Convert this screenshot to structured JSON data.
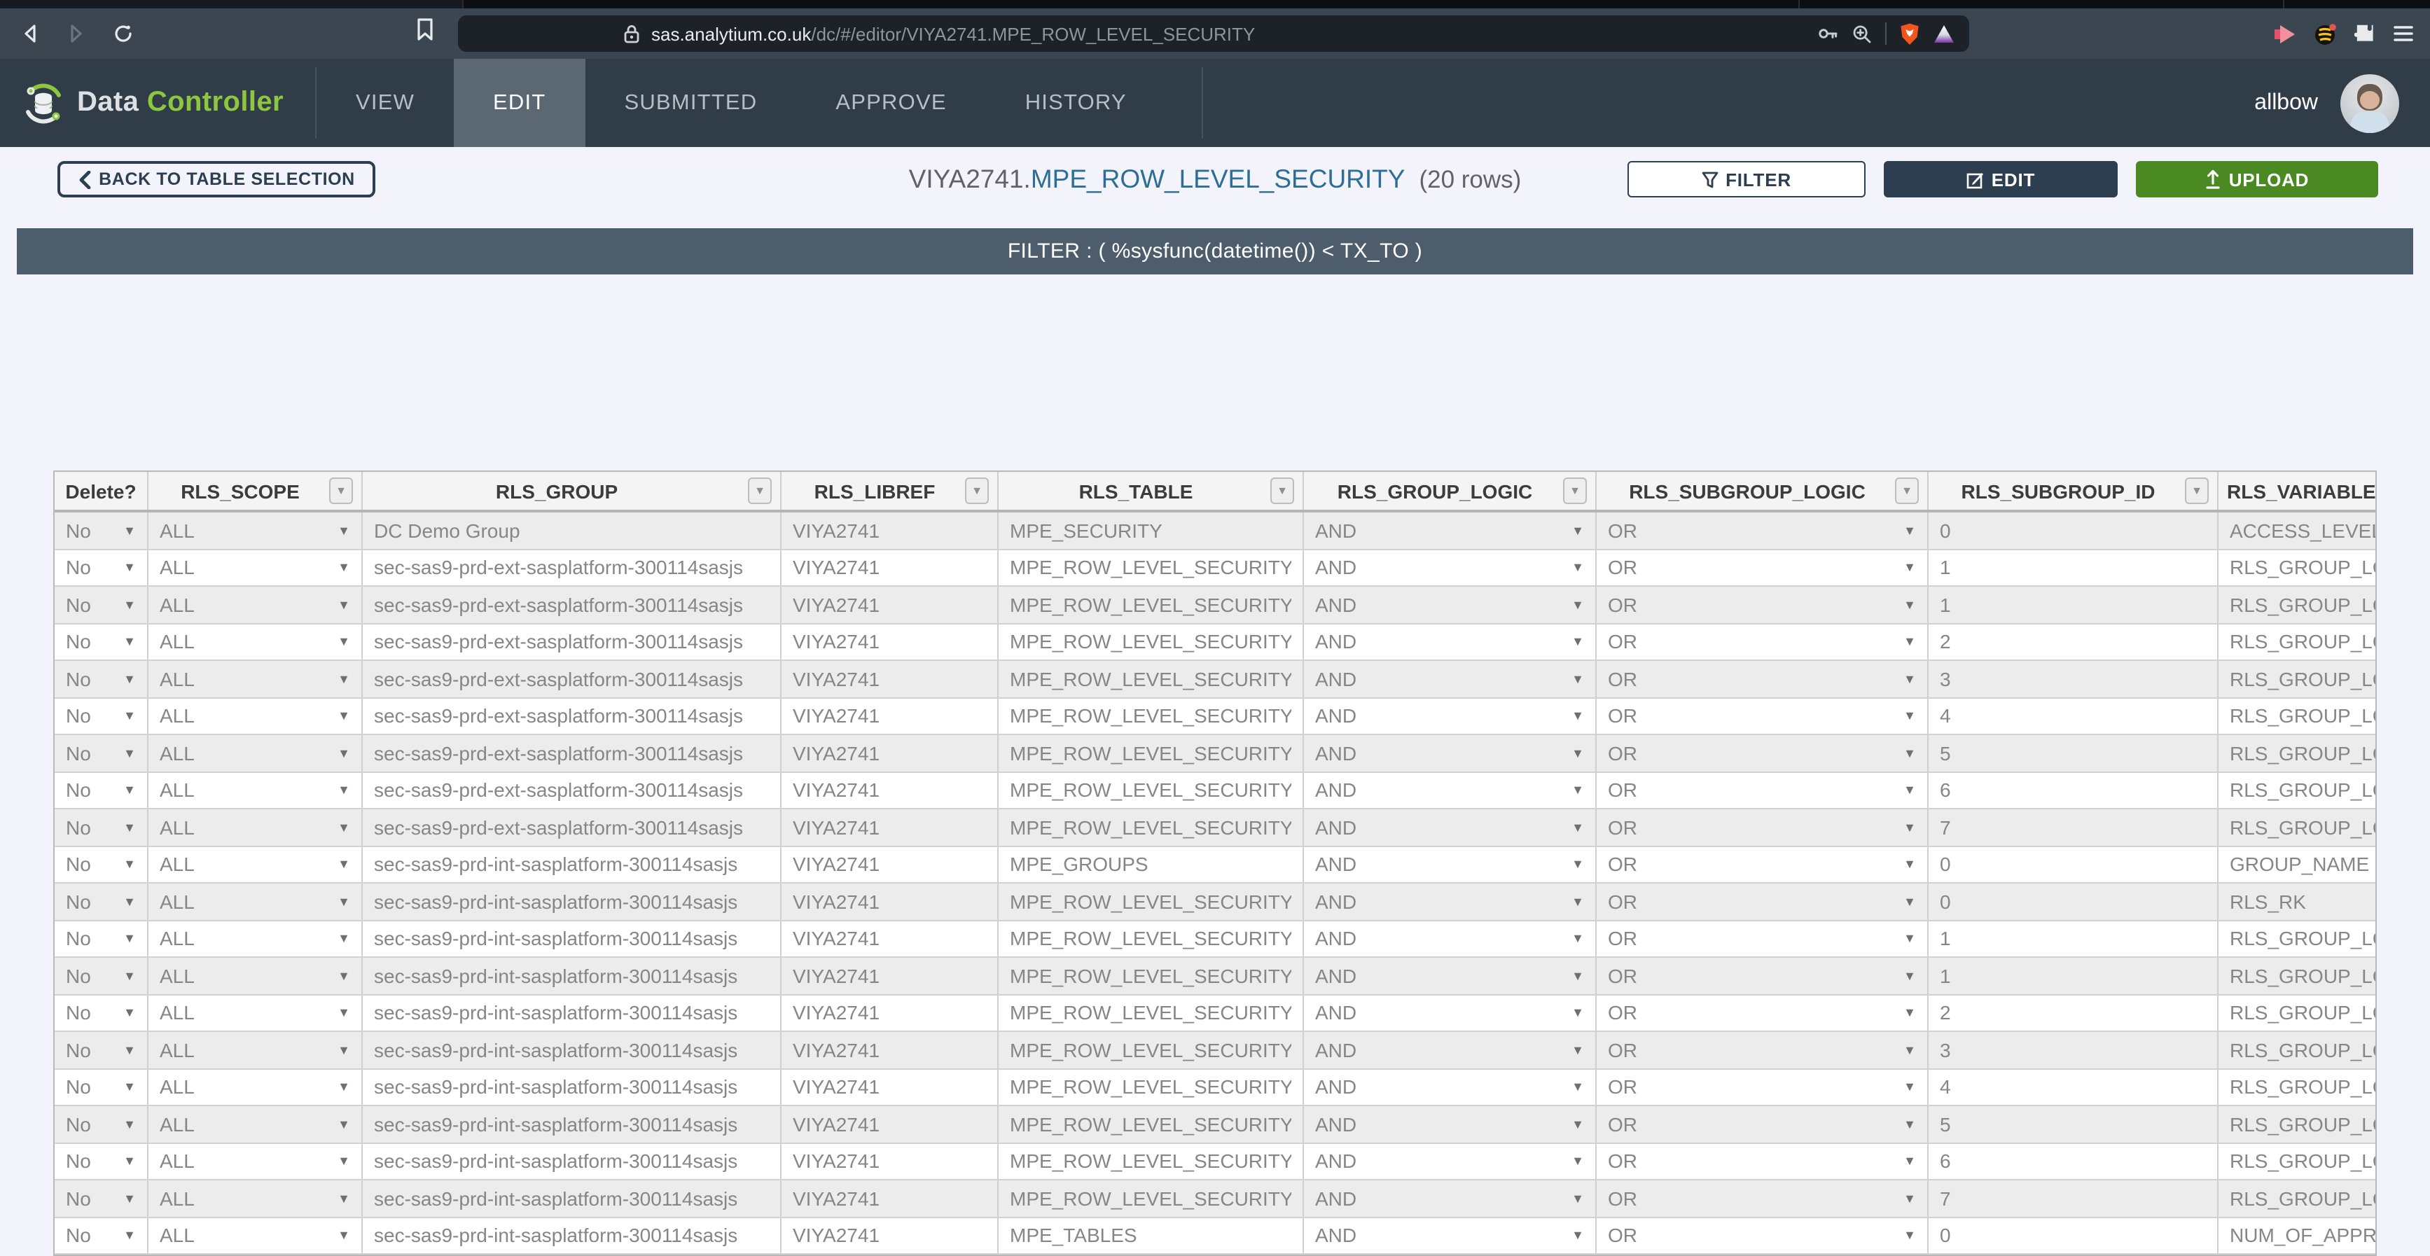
{
  "browser": {
    "url_host": "sas.analytium.co.uk",
    "url_path": "/dc/#/editor/VIYA2741.MPE_ROW_LEVEL_SECURITY"
  },
  "nav": {
    "brand_part1": "Data",
    "brand_part2": "Controller",
    "tabs": [
      {
        "label": "VIEW",
        "active": false
      },
      {
        "label": "EDIT",
        "active": true
      },
      {
        "label": "SUBMITTED",
        "active": false
      },
      {
        "label": "APPROVE",
        "active": false
      },
      {
        "label": "HISTORY",
        "active": false
      }
    ],
    "user": "allbow"
  },
  "header": {
    "back_label": "BACK TO TABLE SELECTION",
    "title_lib": "VIYA2741.",
    "title_table": "MPE_ROW_LEVEL_SECURITY",
    "title_rows": "(20 rows)",
    "filter_label": "FILTER",
    "edit_label": "EDIT",
    "upload_label": "UPLOAD"
  },
  "filter_bar": "FILTER : ( %sysfunc(datetime()) < TX_TO )",
  "table": {
    "columns": [
      {
        "key": "delete",
        "label": "Delete?",
        "filter_icon": false,
        "dropdown": true
      },
      {
        "key": "scope",
        "label": "RLS_SCOPE",
        "filter_icon": true,
        "dropdown": true
      },
      {
        "key": "group",
        "label": "RLS_GROUP",
        "filter_icon": true,
        "dropdown": false
      },
      {
        "key": "libref",
        "label": "RLS_LIBREF",
        "filter_icon": true,
        "dropdown": false
      },
      {
        "key": "table",
        "label": "RLS_TABLE",
        "filter_icon": true,
        "dropdown": false
      },
      {
        "key": "group_logic",
        "label": "RLS_GROUP_LOGIC",
        "filter_icon": true,
        "dropdown": true
      },
      {
        "key": "subgroup_logic",
        "label": "RLS_SUBGROUP_LOGIC",
        "filter_icon": true,
        "dropdown": true
      },
      {
        "key": "subgroup_id",
        "label": "RLS_SUBGROUP_ID",
        "filter_icon": true,
        "dropdown": false
      },
      {
        "key": "variable",
        "label": "RLS_VARIABLE_NM",
        "filter_icon": true,
        "dropdown": false
      }
    ],
    "rows": [
      {
        "delete": "No",
        "scope": "ALL",
        "group": "DC Demo Group",
        "libref": "VIYA2741",
        "table": "MPE_SECURITY",
        "group_logic": "AND",
        "subgroup_logic": "OR",
        "subgroup_id": "0",
        "variable": "ACCESS_LEVEL"
      },
      {
        "delete": "No",
        "scope": "ALL",
        "group": "sec-sas9-prd-ext-sasplatform-300114sasjs",
        "libref": "VIYA2741",
        "table": "MPE_ROW_LEVEL_SECURITY",
        "group_logic": "AND",
        "subgroup_logic": "OR",
        "subgroup_id": "1",
        "variable": "RLS_GROUP_LOGIC"
      },
      {
        "delete": "No",
        "scope": "ALL",
        "group": "sec-sas9-prd-ext-sasplatform-300114sasjs",
        "libref": "VIYA2741",
        "table": "MPE_ROW_LEVEL_SECURITY",
        "group_logic": "AND",
        "subgroup_logic": "OR",
        "subgroup_id": "1",
        "variable": "RLS_GROUP_LOGIC"
      },
      {
        "delete": "No",
        "scope": "ALL",
        "group": "sec-sas9-prd-ext-sasplatform-300114sasjs",
        "libref": "VIYA2741",
        "table": "MPE_ROW_LEVEL_SECURITY",
        "group_logic": "AND",
        "subgroup_logic": "OR",
        "subgroup_id": "2",
        "variable": "RLS_GROUP_LOGIC"
      },
      {
        "delete": "No",
        "scope": "ALL",
        "group": "sec-sas9-prd-ext-sasplatform-300114sasjs",
        "libref": "VIYA2741",
        "table": "MPE_ROW_LEVEL_SECURITY",
        "group_logic": "AND",
        "subgroup_logic": "OR",
        "subgroup_id": "3",
        "variable": "RLS_GROUP_LOGIC"
      },
      {
        "delete": "No",
        "scope": "ALL",
        "group": "sec-sas9-prd-ext-sasplatform-300114sasjs",
        "libref": "VIYA2741",
        "table": "MPE_ROW_LEVEL_SECURITY",
        "group_logic": "AND",
        "subgroup_logic": "OR",
        "subgroup_id": "4",
        "variable": "RLS_GROUP_LOGIC"
      },
      {
        "delete": "No",
        "scope": "ALL",
        "group": "sec-sas9-prd-ext-sasplatform-300114sasjs",
        "libref": "VIYA2741",
        "table": "MPE_ROW_LEVEL_SECURITY",
        "group_logic": "AND",
        "subgroup_logic": "OR",
        "subgroup_id": "5",
        "variable": "RLS_GROUP_LOGIC"
      },
      {
        "delete": "No",
        "scope": "ALL",
        "group": "sec-sas9-prd-ext-sasplatform-300114sasjs",
        "libref": "VIYA2741",
        "table": "MPE_ROW_LEVEL_SECURITY",
        "group_logic": "AND",
        "subgroup_logic": "OR",
        "subgroup_id": "6",
        "variable": "RLS_GROUP_LOGIC"
      },
      {
        "delete": "No",
        "scope": "ALL",
        "group": "sec-sas9-prd-ext-sasplatform-300114sasjs",
        "libref": "VIYA2741",
        "table": "MPE_ROW_LEVEL_SECURITY",
        "group_logic": "AND",
        "subgroup_logic": "OR",
        "subgroup_id": "7",
        "variable": "RLS_GROUP_LOGIC"
      },
      {
        "delete": "No",
        "scope": "ALL",
        "group": "sec-sas9-prd-int-sasplatform-300114sasjs",
        "libref": "VIYA2741",
        "table": "MPE_GROUPS",
        "group_logic": "AND",
        "subgroup_logic": "OR",
        "subgroup_id": "0",
        "variable": "GROUP_NAME"
      },
      {
        "delete": "No",
        "scope": "ALL",
        "group": "sec-sas9-prd-int-sasplatform-300114sasjs",
        "libref": "VIYA2741",
        "table": "MPE_ROW_LEVEL_SECURITY",
        "group_logic": "AND",
        "subgroup_logic": "OR",
        "subgroup_id": "0",
        "variable": "RLS_RK"
      },
      {
        "delete": "No",
        "scope": "ALL",
        "group": "sec-sas9-prd-int-sasplatform-300114sasjs",
        "libref": "VIYA2741",
        "table": "MPE_ROW_LEVEL_SECURITY",
        "group_logic": "AND",
        "subgroup_logic": "OR",
        "subgroup_id": "1",
        "variable": "RLS_GROUP_LOGIC"
      },
      {
        "delete": "No",
        "scope": "ALL",
        "group": "sec-sas9-prd-int-sasplatform-300114sasjs",
        "libref": "VIYA2741",
        "table": "MPE_ROW_LEVEL_SECURITY",
        "group_logic": "AND",
        "subgroup_logic": "OR",
        "subgroup_id": "1",
        "variable": "RLS_GROUP_LOGIC"
      },
      {
        "delete": "No",
        "scope": "ALL",
        "group": "sec-sas9-prd-int-sasplatform-300114sasjs",
        "libref": "VIYA2741",
        "table": "MPE_ROW_LEVEL_SECURITY",
        "group_logic": "AND",
        "subgroup_logic": "OR",
        "subgroup_id": "2",
        "variable": "RLS_GROUP_LOGIC"
      },
      {
        "delete": "No",
        "scope": "ALL",
        "group": "sec-sas9-prd-int-sasplatform-300114sasjs",
        "libref": "VIYA2741",
        "table": "MPE_ROW_LEVEL_SECURITY",
        "group_logic": "AND",
        "subgroup_logic": "OR",
        "subgroup_id": "3",
        "variable": "RLS_GROUP_LOGIC"
      },
      {
        "delete": "No",
        "scope": "ALL",
        "group": "sec-sas9-prd-int-sasplatform-300114sasjs",
        "libref": "VIYA2741",
        "table": "MPE_ROW_LEVEL_SECURITY",
        "group_logic": "AND",
        "subgroup_logic": "OR",
        "subgroup_id": "4",
        "variable": "RLS_GROUP_LOGIC"
      },
      {
        "delete": "No",
        "scope": "ALL",
        "group": "sec-sas9-prd-int-sasplatform-300114sasjs",
        "libref": "VIYA2741",
        "table": "MPE_ROW_LEVEL_SECURITY",
        "group_logic": "AND",
        "subgroup_logic": "OR",
        "subgroup_id": "5",
        "variable": "RLS_GROUP_LOGIC"
      },
      {
        "delete": "No",
        "scope": "ALL",
        "group": "sec-sas9-prd-int-sasplatform-300114sasjs",
        "libref": "VIYA2741",
        "table": "MPE_ROW_LEVEL_SECURITY",
        "group_logic": "AND",
        "subgroup_logic": "OR",
        "subgroup_id": "6",
        "variable": "RLS_GROUP_LOGIC"
      },
      {
        "delete": "No",
        "scope": "ALL",
        "group": "sec-sas9-prd-int-sasplatform-300114sasjs",
        "libref": "VIYA2741",
        "table": "MPE_ROW_LEVEL_SECURITY",
        "group_logic": "AND",
        "subgroup_logic": "OR",
        "subgroup_id": "7",
        "variable": "RLS_GROUP_LOGIC"
      },
      {
        "delete": "No",
        "scope": "ALL",
        "group": "sec-sas9-prd-int-sasplatform-300114sasjs",
        "libref": "VIYA2741",
        "table": "MPE_TABLES",
        "group_logic": "AND",
        "subgroup_logic": "OR",
        "subgroup_id": "0",
        "variable": "NUM_OF_APPROVALS"
      }
    ]
  },
  "colors": {
    "brand_green": "#8dc63f",
    "dark_slate": "#2c3e50",
    "upload_green": "#4b8a22",
    "filter_bar_bg": "#4e5d6c",
    "title_blue": "#2e6d96",
    "nav_bg": "#303d49",
    "active_tab_bg": "#5b6873"
  }
}
